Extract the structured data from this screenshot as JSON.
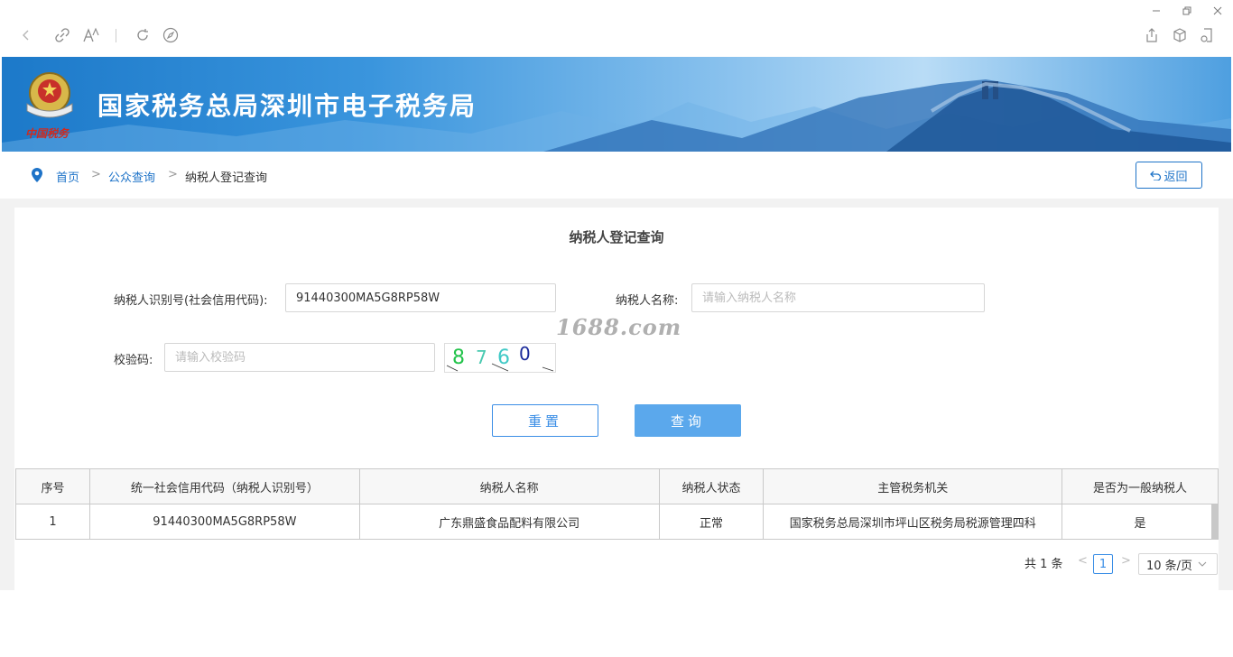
{
  "site": {
    "title": "国家税务总局深圳市电子税务局",
    "logo_text": "中国税务"
  },
  "breadcrumb": {
    "home": "首页",
    "separator": ">",
    "public_query": "公众查询",
    "current": "纳税人登记查询"
  },
  "return_button": "返回",
  "form": {
    "title": "纳税人登记查询",
    "taxpayer_id_label": "纳税人识别号(社会信用代码):",
    "taxpayer_id_value": "91440300MA5G8RP58W",
    "taxpayer_name_label": "纳税人名称:",
    "taxpayer_name_placeholder": "请输入纳税人名称",
    "captcha_label": "校验码:",
    "captcha_placeholder": "请输入校验码",
    "captcha_digits": [
      "8",
      "7",
      "6",
      "0"
    ],
    "captcha_colors": [
      "#22c34a",
      "#49c9b0",
      "#3fc9c6",
      "#1a2a9a"
    ],
    "reset_button": "重置",
    "query_button": "查询"
  },
  "watermark": "1688.com",
  "table": {
    "headers": [
      "序号",
      "统一社会信用代码（纳税人识别号）",
      "纳税人名称",
      "纳税人状态",
      "主管税务机关",
      "是否为一般纳税人"
    ],
    "rows": [
      [
        "1",
        "91440300MA5G8RP58W",
        "广东鼎盛食品配料有限公司",
        "正常",
        "国家税务总局深圳市坪山区税务局税源管理四科",
        "是"
      ]
    ]
  },
  "pagination": {
    "total_text": "共 1 条",
    "prev": "<",
    "current_page": "1",
    "next": ">",
    "page_size": "10 条/页"
  },
  "colors": {
    "accent": "#1e73c8",
    "button_primary": "#5ba8ec",
    "banner": "#2a88d6"
  }
}
